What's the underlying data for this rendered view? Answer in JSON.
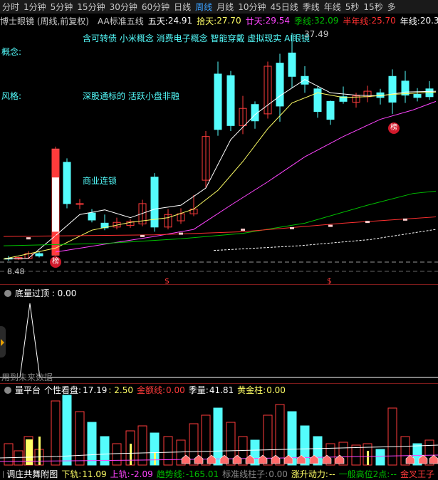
{
  "toolbar": {
    "items": [
      "分时",
      "1分钟",
      "5分钟",
      "15分钟",
      "30分钟",
      "60分钟",
      "日线",
      "周线",
      "月线",
      "10分钟",
      "45日线",
      "季线",
      "年线",
      "5秒",
      "15秒",
      "多"
    ],
    "active_index": 7
  },
  "title": {
    "stock": "博士眼镜 (周线,前复权)",
    "indicator": "AA标准五线",
    "wutian_label": "五天:",
    "wutian_value": "24.91",
    "shitian_label": "拾天:",
    "shitian_value": "27.70",
    "nianshi_label": "廿天:",
    "nianshi_value": "29.54",
    "ji_label": "季线:",
    "ji_value": "32.09",
    "bannian_label": "半年线:",
    "bannian_value": "25.70",
    "nian_label": "年线:",
    "nian_value": "20.3"
  },
  "main": {
    "concept_label": "概念:",
    "concept_text": "含可转债 小米概念 消费电子概念 智能穿戴 虚拟现实 AI眼镜",
    "style_label": "风格:",
    "style_text": "深股通标的 活跃小盘非融",
    "industry_text": "商业连锁",
    "high_price": "37.49",
    "low_price": "8.48",
    "badge_text": "榜",
    "dollar_mark": "$"
  },
  "sub1": {
    "label": "底量过顶 : 0.00",
    "note": "用到未来数据"
  },
  "sub2": {
    "label_name": "量平台",
    "label_curve": "个性看盘:",
    "label_curve_value": "17.19",
    "label_val2": ": 2.50",
    "label_gold": "金额线:",
    "label_gold_value": "0.00",
    "label_ji": "季量:",
    "label_ji_value": "41.81",
    "label_pillar": "黄金柱:",
    "label_pillar_value": "0.00"
  },
  "bottom": {
    "name": "调庄共舞附图",
    "xia_label": "下轨:",
    "xia_value": "11.09",
    "shang_label": "上轨:",
    "shang_value": "-2.09",
    "trend_label": "趋势线:",
    "trend_value": "-165.01",
    "pole_label": "标准线柱子:",
    "pole_value": "0.00",
    "rise_label": "涨升动力:",
    "rise_value": "--",
    "high_label": "一般高位2点:",
    "high_value": "--",
    "gold_label": "金叉王子"
  },
  "colors": {
    "up": "#ff3b3b",
    "down": "#54fcfc",
    "ma5": "#ffffff",
    "ma10": "#ffff66",
    "ma20": "#ff44ff",
    "ma60": "#00c000",
    "ma120": "#ff3030",
    "ma250": "#ffffff",
    "accent": "#3aa0ff"
  },
  "icons": [
    "gear-icon",
    "settings-icon",
    "side-expand-icon"
  ]
}
